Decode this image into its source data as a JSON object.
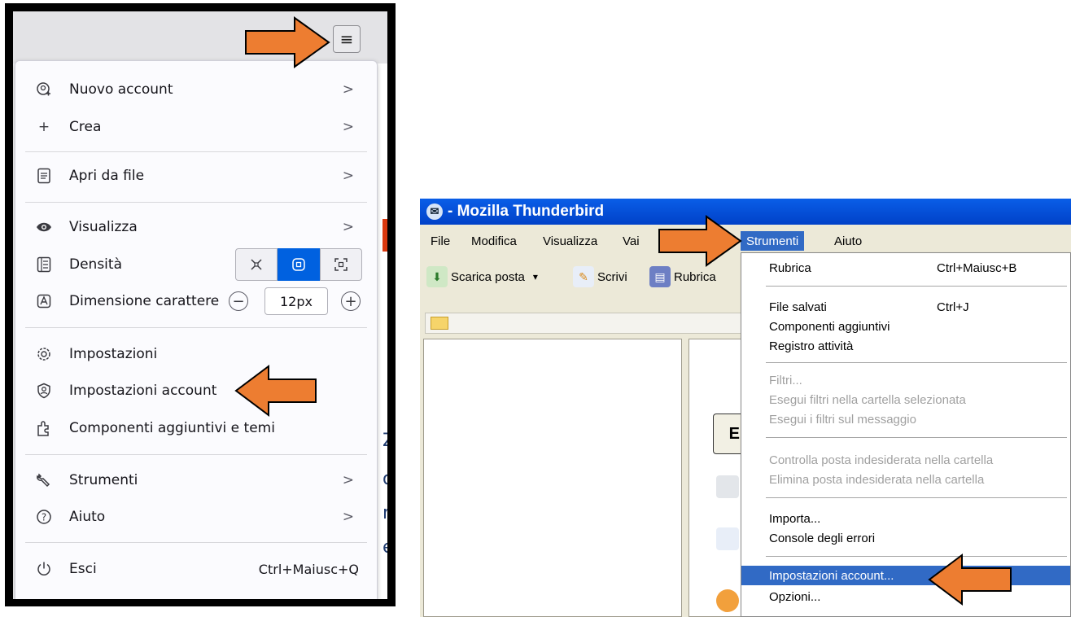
{
  "left": {
    "hamburger_symbol": "≡",
    "background_peek": [
      "Ci",
      "Zi",
      "oi",
      "re",
      "e"
    ],
    "menu_items": [
      {
        "icon": "account-add-icon",
        "label": "Nuovo account",
        "has_submenu": true
      },
      {
        "icon": "plus-icon",
        "label": "Crea",
        "has_submenu": true
      },
      {
        "icon": "file-open-icon",
        "label": "Apri da file",
        "has_submenu": true
      },
      {
        "icon": "eye-icon",
        "label": "Visualizza",
        "has_submenu": true
      },
      {
        "icon": "density-icon",
        "label": "Densità"
      },
      {
        "icon": "font-size-icon",
        "label": "Dimensione carattere"
      },
      {
        "icon": "settings-icon",
        "label": "Impostazioni"
      },
      {
        "icon": "account-settings-icon",
        "label": "Impostazioni account"
      },
      {
        "icon": "addons-icon",
        "label": "Componenti aggiuntivi e temi"
      },
      {
        "icon": "wrench-icon",
        "label": "Strumenti",
        "has_submenu": true
      },
      {
        "icon": "help-icon",
        "label": "Aiuto",
        "has_submenu": true
      },
      {
        "icon": "power-icon",
        "label": "Esci",
        "shortcut": "Ctrl+Maiusc+Q"
      }
    ],
    "density_options": [
      "compact",
      "normal",
      "touch"
    ],
    "density_selected": "normal",
    "font_size": "12px",
    "zoom_minus": "−",
    "zoom_plus": "+"
  },
  "right": {
    "window_title": "- Mozilla Thunderbird",
    "menubar": [
      "File",
      "Modifica",
      "Visualizza",
      "Vai",
      "Strumenti",
      "Aiuto"
    ],
    "active_menu": "Strumenti",
    "toolbar": [
      {
        "label": "Scarica posta",
        "icon": "download-mail-icon",
        "dropdown": "▾"
      },
      {
        "label": "Scrivi",
        "icon": "compose-icon"
      },
      {
        "label": "Rubrica",
        "icon": "address-book-icon"
      }
    ],
    "peek_button_text": "E",
    "tools_menu": {
      "rubrica": {
        "label": "Rubrica",
        "shortcut": "Ctrl+Maiusc+B"
      },
      "file_salvati": {
        "label": "File salvati",
        "shortcut": "Ctrl+J"
      },
      "componenti": {
        "label": "Componenti aggiuntivi"
      },
      "registro": {
        "label": "Registro attività"
      },
      "filtri": {
        "label": "Filtri..."
      },
      "esegui_cartella": {
        "label": "Esegui filtri nella cartella selezionata"
      },
      "esegui_messaggio": {
        "label": "Esegui i filtri sul messaggio"
      },
      "controlla": {
        "label": "Controlla posta indesiderata nella cartella"
      },
      "elimina": {
        "label": "Elimina posta indesiderata nella cartella"
      },
      "importa": {
        "label": "Importa..."
      },
      "console": {
        "label": "Console degli errori"
      },
      "impostazioni_account": {
        "label": "Impostazioni account..."
      },
      "opzioni": {
        "label": "Opzioni..."
      }
    }
  },
  "colors": {
    "arrow_fill": "#ed7d31",
    "arrow_stroke": "#000000",
    "selection_blue": "#316ac5",
    "titlebar_blue": "#0a5ee8",
    "density_selected": "#0061e0"
  }
}
